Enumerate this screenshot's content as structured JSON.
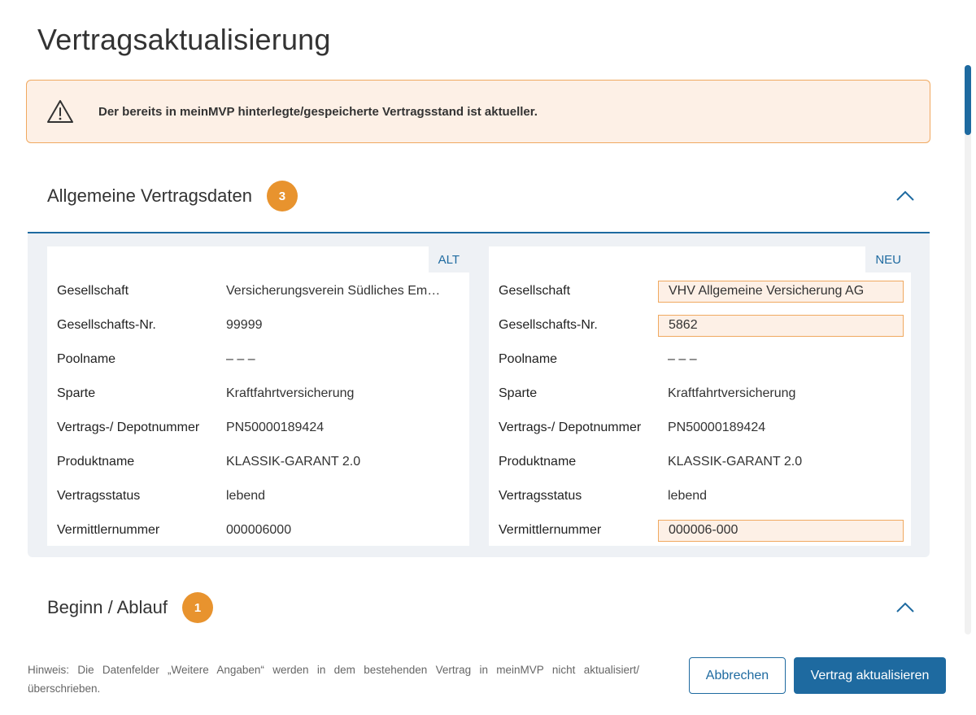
{
  "page": {
    "title": "Vertragsaktualisierung"
  },
  "warning": {
    "icon": "warning-triangle-icon",
    "text": "Der bereits in meinMVP hinterlegte/gespeicherte Vertragsstand ist aktueller."
  },
  "colors": {
    "accent": "#1e6aa0",
    "badge": "#e8932e",
    "changed_bg": "#fdf0e6",
    "changed_border": "#f0a960"
  },
  "sections": [
    {
      "title": "Allgemeine Vertragsdaten",
      "badge": "3",
      "expanded": true,
      "toggle_icon": "chevron-up-icon"
    },
    {
      "title": "Beginn / Ablauf",
      "badge": "1",
      "expanded": true,
      "toggle_icon": "chevron-up-icon"
    }
  ],
  "comparison": {
    "old": {
      "tag": "ALT",
      "rows": [
        {
          "label": "Gesellschaft",
          "value": "Versicherungsverein Südliches Em…",
          "changed": false
        },
        {
          "label": "Gesellschafts-Nr.",
          "value": "99999",
          "changed": false
        },
        {
          "label": "Poolname",
          "value": "– – –",
          "changed": false
        },
        {
          "label": "Sparte",
          "value": "Kraftfahrtversicherung",
          "changed": false
        },
        {
          "label": "Vertrags-/ Depotnummer",
          "value": "PN50000189424",
          "changed": false
        },
        {
          "label": "Produktname",
          "value": "KLASSIK-GARANT 2.0",
          "changed": false
        },
        {
          "label": "Vertragsstatus",
          "value": "lebend",
          "changed": false
        },
        {
          "label": "Vermittlernummer",
          "value": "000006000",
          "changed": false
        }
      ]
    },
    "new": {
      "tag": "NEU",
      "rows": [
        {
          "label": "Gesellschaft",
          "value": "VHV Allgemeine Versicherung AG",
          "changed": true
        },
        {
          "label": "Gesellschafts-Nr.",
          "value": "5862",
          "changed": true
        },
        {
          "label": "Poolname",
          "value": "– – –",
          "changed": false
        },
        {
          "label": "Sparte",
          "value": "Kraftfahrtversicherung",
          "changed": false
        },
        {
          "label": "Vertrags-/ Depotnummer",
          "value": "PN50000189424",
          "changed": false
        },
        {
          "label": "Produktname",
          "value": "KLASSIK-GARANT 2.0",
          "changed": false
        },
        {
          "label": "Vertragsstatus",
          "value": "lebend",
          "changed": false
        },
        {
          "label": "Vermittlernummer",
          "value": "000006-000",
          "changed": true
        }
      ]
    }
  },
  "footer": {
    "hint": "Hinweis: Die Datenfelder „Weitere Angaben“ werden in dem bestehenden Vertrag in meinMVP nicht aktualisiert/ überschrieben.",
    "cancel_label": "Abbrechen",
    "submit_label": "Vertrag aktualisieren"
  }
}
